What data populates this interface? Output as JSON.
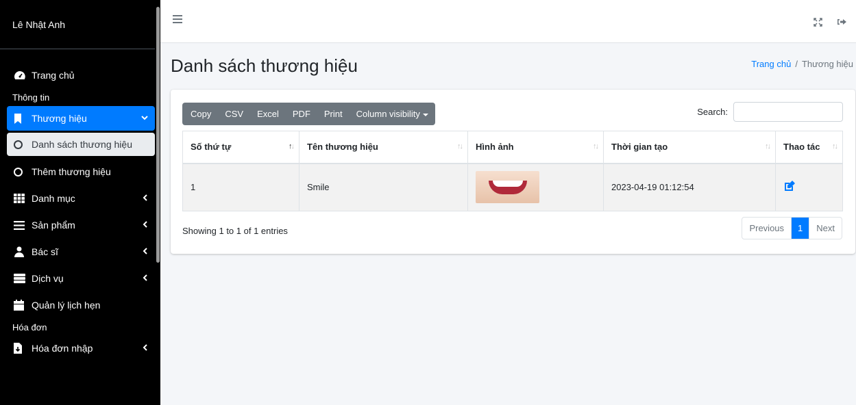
{
  "sidebar": {
    "brand": "Lê Nhật Anh",
    "home": {
      "label": "Trang chủ",
      "icon": "dashboard-icon"
    },
    "header_info": "Thông tin",
    "brand_menu": {
      "label": "Thương hiệu",
      "icon": "bookmark-icon"
    },
    "brand_list": {
      "label": "Danh sách thương hiệu",
      "icon": "circle-icon"
    },
    "brand_add": {
      "label": "Thêm thương hiệu",
      "icon": "circle-icon"
    },
    "items": [
      {
        "label": "Danh mục",
        "icon": "grid-icon"
      },
      {
        "label": "Sản phẩm",
        "icon": "bars-icon"
      },
      {
        "label": "Bác sĩ",
        "icon": "doctor-icon"
      },
      {
        "label": "Dịch vụ",
        "icon": "server-icon"
      }
    ],
    "appointments": {
      "label": "Quản lý lịch hẹn",
      "icon": "calendar-icon"
    },
    "header_invoice": "Hóa đơn",
    "invoice_in": {
      "label": "Hóa đơn nhập",
      "icon": "file-download-icon"
    },
    "active_color": "#007bff"
  },
  "page": {
    "title": "Danh sách thương hiệu",
    "breadcrumb": {
      "home": "Trang chủ",
      "sep": "/",
      "current": "Thương hiệu"
    }
  },
  "toolbar": {
    "buttons": [
      "Copy",
      "CSV",
      "Excel",
      "PDF",
      "Print"
    ],
    "column_visibility": "Column visibility",
    "search_label": "Search:",
    "search_value": ""
  },
  "table": {
    "columns": [
      "Số thứ tự",
      "Tên thương hiệu",
      "Hình ảnh",
      "Thời gian tạo",
      "Thao tác"
    ],
    "rows": [
      {
        "index": "1",
        "name": "Smile",
        "image": "smile-thumbnail",
        "created": "2023-04-19 01:12:54",
        "action": "edit-icon"
      }
    ]
  },
  "footer": {
    "info": "Showing 1 to 1 of 1 entries",
    "pager": {
      "prev": "Previous",
      "current": "1",
      "next": "Next"
    }
  }
}
